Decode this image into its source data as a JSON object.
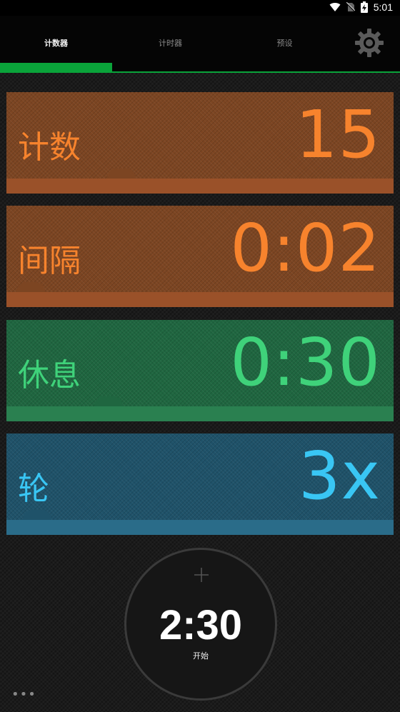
{
  "status_bar": {
    "time": "5:01",
    "icons": [
      "wifi-icon",
      "no-sim-icon",
      "battery-charging-icon"
    ]
  },
  "tabs": [
    {
      "label": "计数器",
      "active": true
    },
    {
      "label": "计时器",
      "active": false
    },
    {
      "label": "预设",
      "active": false
    }
  ],
  "settings": {
    "icon": "gear-icon"
  },
  "cards": [
    {
      "label": "计数",
      "value": "15",
      "color": "#f7832d",
      "bg": "#7c4522",
      "strip": "#9a5129"
    },
    {
      "label": "间隔",
      "value": "0:02",
      "color": "#f7832d",
      "bg": "#7c4522",
      "strip": "#9a5129"
    },
    {
      "label": "休息",
      "value": "0:30",
      "color": "#3fd27a",
      "bg": "#1f6640",
      "strip": "#2a8050"
    },
    {
      "label": "轮",
      "value": "3x",
      "color": "#39c6f4",
      "bg": "#1f5269",
      "strip": "#2a6c89"
    }
  ],
  "dial": {
    "time": "2:30",
    "start_label": "开始",
    "plus_icon": "plus-icon"
  },
  "more": {
    "icon": "more-dots-icon",
    "text": "•••"
  }
}
